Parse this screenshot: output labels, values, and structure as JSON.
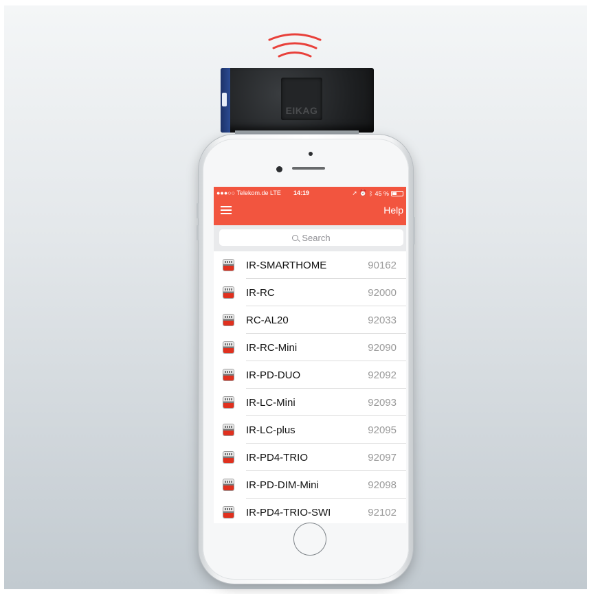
{
  "colors": {
    "accent": "#f2553f",
    "signal": "#e8403a",
    "dongle_body": "#1e2022",
    "dongle_side": "#2b4b93"
  },
  "dongle": {
    "logo_text": "EIKAG"
  },
  "status_bar": {
    "carrier": "●●●○○ Telekom.de  LTE",
    "time": "14:19",
    "battery_text": "45 %",
    "battery_level": 0.45
  },
  "nav": {
    "menu_icon": "hamburger-menu-icon",
    "help_label": "Help"
  },
  "search": {
    "placeholder": "Search"
  },
  "devices": [
    {
      "name": "IR-SMARTHOME",
      "number": "90162"
    },
    {
      "name": "IR-RC",
      "number": "92000"
    },
    {
      "name": "RC-AL20",
      "number": "92033"
    },
    {
      "name": "IR-RC-Mini",
      "number": "92090"
    },
    {
      "name": "IR-PD-DUO",
      "number": "92092"
    },
    {
      "name": "IR-LC-Mini",
      "number": "92093"
    },
    {
      "name": "IR-LC-plus",
      "number": "92095"
    },
    {
      "name": "IR-PD4-TRIO",
      "number": "92097"
    },
    {
      "name": "IR-PD-DIM-Mini",
      "number": "92098"
    },
    {
      "name": "IR-PD4-TRIO-SWI",
      "number": "92102"
    }
  ]
}
